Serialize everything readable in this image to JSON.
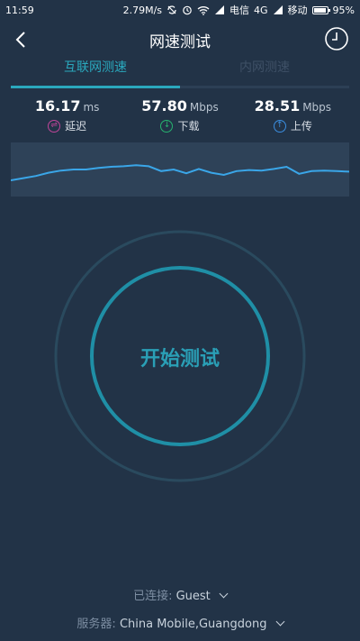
{
  "status_bar": {
    "time": "11:59",
    "speed": "2.79M/s",
    "carrier1": "电信",
    "network1": "4G",
    "carrier2": "移动",
    "battery": "95%",
    "battery_level": 0.95
  },
  "header": {
    "title": "网速测试",
    "back_icon": "chevron-left-icon",
    "history_icon": "clock-icon"
  },
  "tabs": [
    {
      "label": "互联网测速",
      "active": true
    },
    {
      "label": "内网测速",
      "active": false
    }
  ],
  "metrics": {
    "latency": {
      "value": "16.17",
      "unit": "ms",
      "label": "延迟",
      "color": "#c0459a",
      "icon": "latency-icon"
    },
    "download": {
      "value": "57.80",
      "unit": "Mbps",
      "label": "下载",
      "color": "#27b36f",
      "icon": "download-arrow-icon"
    },
    "upload": {
      "value": "28.51",
      "unit": "Mbps",
      "label": "上传",
      "color": "#3b8ee0",
      "icon": "upload-arrow-icon"
    }
  },
  "chart_data": {
    "type": "line",
    "color": "#3aa6e8",
    "values": [
      10,
      14,
      18,
      24,
      28,
      30,
      30,
      33,
      35,
      36,
      38,
      36,
      27,
      30,
      23,
      31,
      24,
      20,
      27,
      29,
      28,
      31,
      35,
      22,
      27,
      28,
      27,
      26
    ]
  },
  "start_button": {
    "label": "开始测试"
  },
  "connection": {
    "label": "已连接:",
    "value": "Guest"
  },
  "server": {
    "label": "服务器:",
    "value": "China Mobile,Guangdong"
  },
  "colors": {
    "background": "#223347",
    "accent": "#2aa8bd"
  }
}
